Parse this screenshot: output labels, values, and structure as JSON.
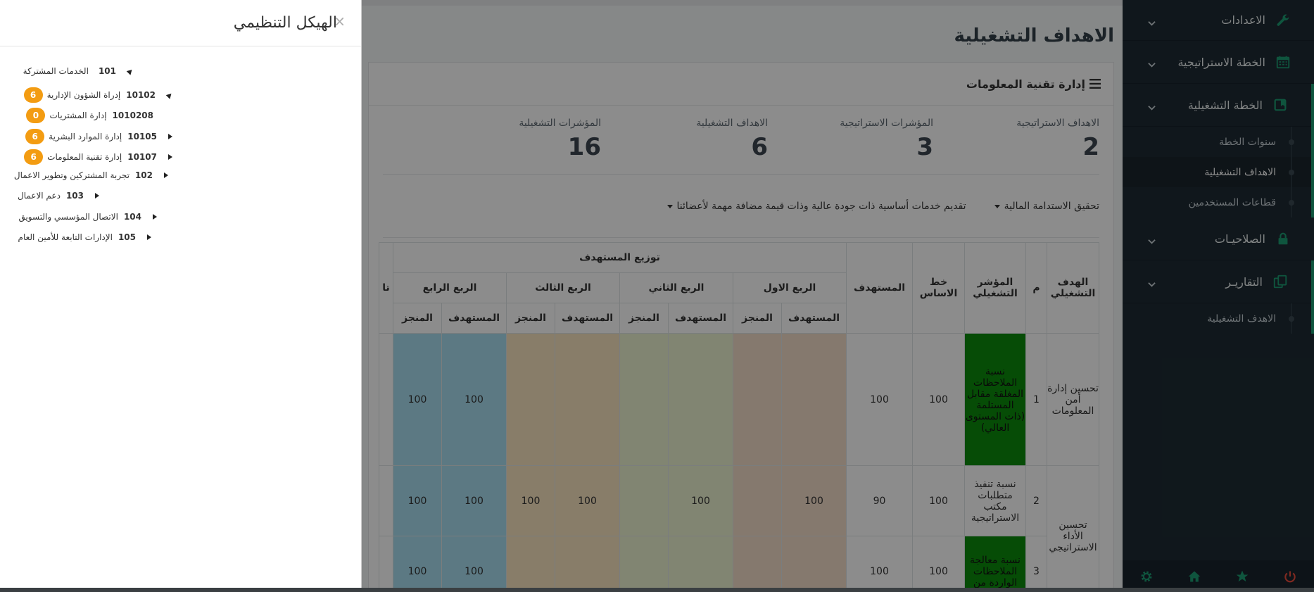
{
  "sidebar": {
    "groups": [
      {
        "label": "الاعدادات",
        "icon": "wrench-icon"
      },
      {
        "label": "الخطة الاستراتيجية",
        "icon": "calendar-icon"
      },
      {
        "label": "الخطة التشغيلية",
        "icon": "bookmark-icon"
      },
      {
        "label": "الصلاحيـات",
        "icon": "lock-icon"
      },
      {
        "label": "التقاريـر",
        "icon": "copy-icon"
      }
    ],
    "operational_sub": [
      "سنوات الخطة",
      "الاهداف التشغيلية",
      "قطاعات المستخدمين"
    ],
    "reports_sub": [
      "الاهدف التشغيلية"
    ],
    "footer_icons": [
      "gear-icon",
      "home-icon",
      "star-icon",
      "power-icon"
    ],
    "accent": "#1d9c72"
  },
  "main": {
    "page_title": "الاهداف التشغيلية",
    "card_title": "إدارة تقنية المعلومات",
    "stats": [
      {
        "label": "الاهداف الاستراتيجية",
        "value": "2"
      },
      {
        "label": "المؤشرات الاستراتيجية",
        "value": "3"
      },
      {
        "label": "الاهداف التشغيلية",
        "value": "6"
      },
      {
        "label": "المؤشرات التشغيلية",
        "value": "16"
      }
    ],
    "filters": [
      "تحقيق الاستدامة المالية",
      "تقديم خدمات أساسية ذات جودة عالية وذات قيمة مضافة مهمة لأعضائنا"
    ],
    "table": {
      "headers": {
        "goal": "الهدف التشغيلي",
        "num": "م",
        "indicator": "المؤشر التشغيلي",
        "baseline": "خط الاساس",
        "target": "المستهدف",
        "distribution": "توزيع المستهدف",
        "q1": "الربع الاول",
        "q2": "الربع الثاني",
        "q3": "الربع الثالث",
        "q4": "الربع الرابع",
        "target_sub": "المستهدف",
        "done_sub": "المنجز",
        "cut": "تا"
      },
      "rows": [
        {
          "goal": "تحسين إدارة أمن المعلومات",
          "num": "1",
          "indicator": "نسبة الملاحظات المغلقة مقابل المستلمة (ذات المستوى العالي)",
          "baseline": "100",
          "target": "100",
          "q1t": "",
          "q1d": "",
          "q2t": "",
          "q2d": "",
          "q3t": "",
          "q3d": "",
          "q4t": "100",
          "q4d": "100"
        },
        {
          "goal": "تحسين الأداء الاستراتيجي",
          "num": "2",
          "indicator": "نسبة تنفيذ متطلبات مكتب الاستراتيجية",
          "baseline": "100",
          "target": "90",
          "q1t": "100",
          "q1d": "",
          "q2t": "100",
          "q2d": "",
          "q3t": "100",
          "q3d": "100",
          "q4t": "100",
          "q4d": "100"
        },
        {
          "goal": "",
          "num": "3",
          "indicator": "نسبة معالجة الملاحظات الواردة من",
          "baseline": "100",
          "target": "100",
          "q1t": "",
          "q1d": "",
          "q2t": "",
          "q2d": "",
          "q3t": "",
          "q3d": "",
          "q4t": "100",
          "q4d": "100"
        }
      ]
    }
  },
  "modal": {
    "title": "الهيكل التنظيمي",
    "close": "×",
    "tree": [
      {
        "label": "الخدمات المشتركة",
        "code": "101",
        "open": true,
        "badge": ""
      },
      {
        "label": "إدراة الشؤون الإدارية",
        "code": "10102",
        "open": true,
        "badge": "6"
      },
      {
        "label": "إدارة المشتريات",
        "code": "1010208",
        "open": null,
        "badge": "0"
      },
      {
        "label": "إدارة الموارد البشرية",
        "code": "10105",
        "open": false,
        "badge": "6"
      },
      {
        "label": "إدارة تقنية المعلومات",
        "code": "10107",
        "open": false,
        "badge": "6"
      },
      {
        "label": "تجربة المشتركين وتطوير الاعمال",
        "code": "102",
        "open": false,
        "badge": ""
      },
      {
        "label": "دعم الاعمال",
        "code": "103",
        "open": false,
        "badge": ""
      },
      {
        "label": "الاتصال المؤسسي والتسويق",
        "code": "104",
        "open": false,
        "badge": ""
      },
      {
        "label": "الإدارات التابعة للأمين العام",
        "code": "105",
        "open": false,
        "badge": ""
      }
    ],
    "badge_color": "#f39c12"
  }
}
